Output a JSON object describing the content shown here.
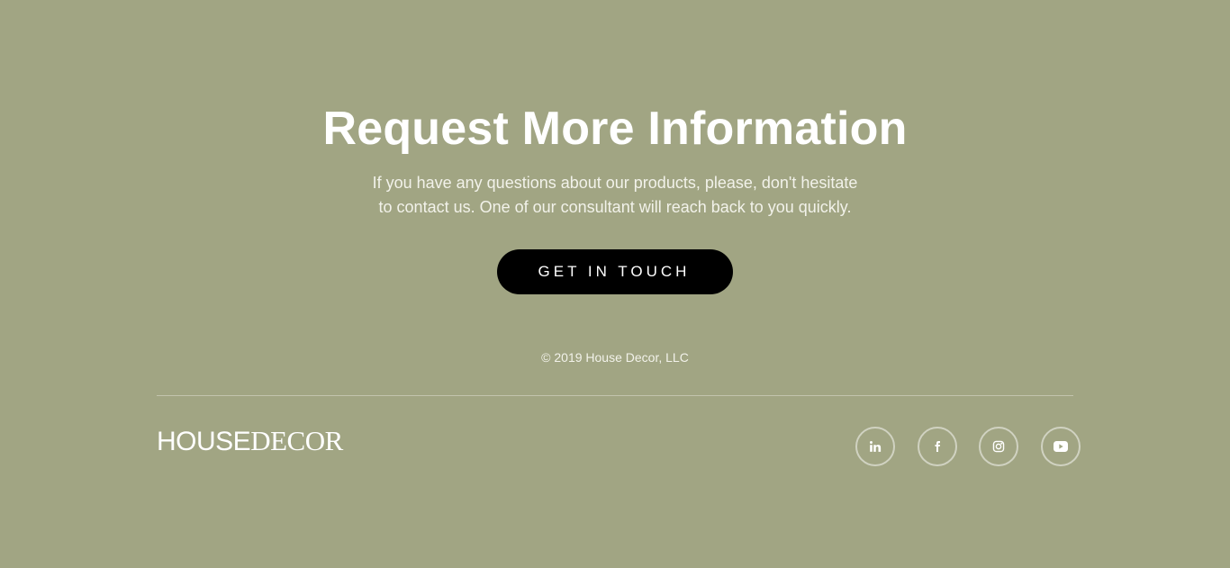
{
  "hero": {
    "title": "Request More Information",
    "subtitle_line1": "If you have any questions about our products, please, don't hesitate",
    "subtitle_line2": "to contact us. One of our consultant will reach back to you quickly.",
    "cta_label": "GET IN TOUCH"
  },
  "footer": {
    "copyright": "© 2019 House Decor, LLC",
    "logo_bold": "HOUSE",
    "logo_light": "DECOR",
    "social": [
      {
        "icon": "linkedin-icon"
      },
      {
        "icon": "facebook-icon"
      },
      {
        "icon": "instagram-icon"
      },
      {
        "icon": "youtube-icon"
      }
    ]
  },
  "colors": {
    "background": "#a1a583",
    "button": "#000000",
    "text": "#ffffff"
  }
}
